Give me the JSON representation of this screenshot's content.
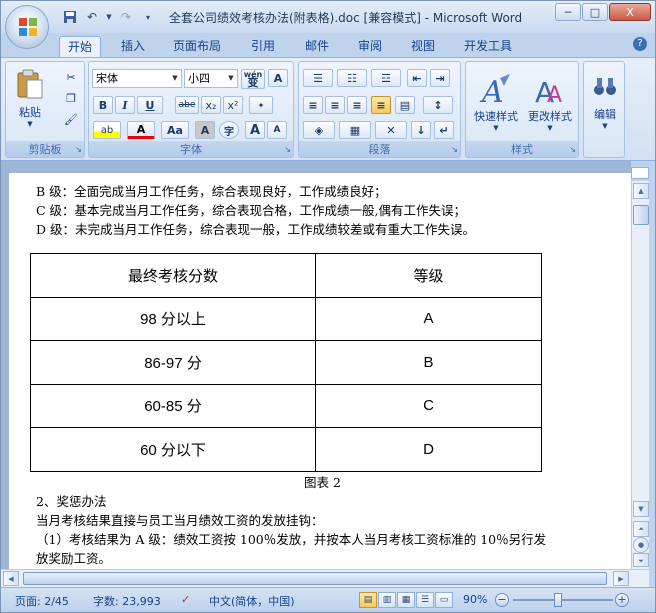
{
  "window": {
    "title": "全套公司绩效考核办法(附表格).doc [兼容模式] - Microsoft Word",
    "minimize": "─",
    "restore": "□",
    "close": "X"
  },
  "tabs": [
    "开始",
    "插入",
    "页面布局",
    "引用",
    "邮件",
    "审阅",
    "视图",
    "开发工具"
  ],
  "ribbon": {
    "clipboard": {
      "label": "剪贴板",
      "paste": "粘贴"
    },
    "font": {
      "label": "字体",
      "name": "宋体",
      "size": "小四",
      "wen": "wén",
      "wen2": "变",
      "A": "A",
      "bold": "B",
      "italic": "I",
      "underline": "U",
      "strike": "abe",
      "sub": "x₂",
      "sup": "x²",
      "highlight": "ab",
      "color": "A",
      "case": "Aa",
      "box": "A",
      "circle": "字",
      "grow": "A",
      "shrink": "A"
    },
    "paragraph": {
      "label": "段落"
    },
    "styles": {
      "label": "样式",
      "quick": "快速样式",
      "change": "更改样式"
    },
    "editing": {
      "label": "编辑"
    }
  },
  "document": {
    "lines_top": [
      "B 级：全面完成当月工作任务，综合表现良好，工作成绩良好；",
      "C 级：基本完成当月工作任务，综合表现合格，工作成绩一般,偶有工作失误；",
      "D 级：未完成当月工作任务，综合表现一般，工作成绩较差或有重大工作失误。"
    ],
    "table": {
      "headers": [
        "最终考核分数",
        "等级"
      ],
      "rows": [
        [
          "98 分以上",
          "A"
        ],
        [
          "86-97 分",
          "B"
        ],
        [
          "60-85 分",
          "C"
        ],
        [
          "60 分以下",
          "D"
        ]
      ]
    },
    "caption": "图表 2",
    "lines_bottom": [
      "2、奖惩办法",
      "当月考核结果直接与员工当月绩效工资的发放挂钩：",
      "（1）考核结果为 A 级：绩效工资按 100％发放，并按本人当月考核工资标准的 10％另行发",
      "放奖励工资。"
    ]
  },
  "status": {
    "page": "页面: 2/45",
    "words": "字数: 23,993",
    "language": "中文(简体，中国)",
    "zoom": "90%"
  }
}
